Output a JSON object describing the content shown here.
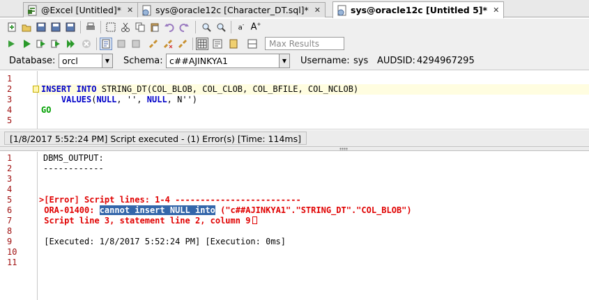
{
  "tabs": [
    {
      "label": "@Excel [Untitled]*",
      "icon": "excel-doc-icon",
      "active": false
    },
    {
      "label": "sys@oracle12c [Character_DT.sql]*",
      "icon": "sql-doc-icon",
      "active": false
    },
    {
      "label": "sys@oracle12c [Untitled 5]*",
      "icon": "sql-doc-icon",
      "active": true
    }
  ],
  "toolbar": {
    "max_results_placeholder": "Max Results"
  },
  "connection": {
    "database_label": "Database:",
    "database_value": "orcl",
    "schema_label": "Schema:",
    "schema_value": "c##AJINKYA1",
    "username_label": "Username:",
    "username_value": "sys",
    "audsid_label": "AUDSID:",
    "audsid_value": "4294967295"
  },
  "editor": {
    "line_numbers": [
      "1",
      "2",
      "3",
      "4",
      "5"
    ],
    "line2_kw1": "INSERT",
    "line2_kw2": "INTO",
    "line2_rest": " STRING_DT(COL_BLOB, COL_CLOB, COL_BFILE, COL_NCLOB)",
    "line3_indent": "    ",
    "line3_kw": "VALUES",
    "line3_a": "(",
    "line3_null1": "NULL",
    "line3_b": ", '', ",
    "line3_null2": "NULL",
    "line3_c": ", N'')",
    "line4_kw": "GO"
  },
  "status": {
    "message": "[1/8/2017 5:52:24 PM] Script executed - (1) Error(s) [Time: 114ms]"
  },
  "output": {
    "line_numbers": [
      "1",
      "2",
      "3",
      "4",
      "5",
      "6",
      "7",
      "8",
      "9",
      "10",
      "11"
    ],
    "line1": "DBMS_OUTPUT:",
    "line2": "------------",
    "line5": ">[Error] Script lines: 1-4 -------------------------",
    "line6_prefix": " ORA-01400: ",
    "line6_selected": "cannot insert NULL into",
    "line6_suffix": " (\"c##AJINKYA1\".\"STRING_DT\".\"COL_BLOB\")",
    "line7": " Script line 3, statement line 2, column 9",
    "line9": " [Executed: 1/8/2017 5:52:24 PM] [Execution: 0ms]"
  }
}
